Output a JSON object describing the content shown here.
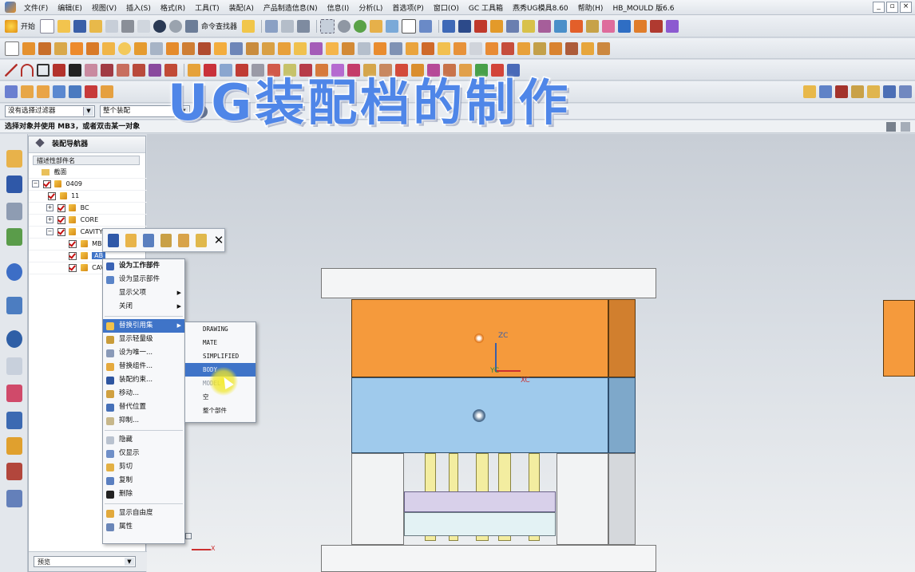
{
  "menubar": {
    "items": [
      "文件(F)",
      "编辑(E)",
      "视图(V)",
      "插入(S)",
      "格式(R)",
      "工具(T)",
      "装配(A)",
      "产品制造信息(N)",
      "信息(I)",
      "分析(L)",
      "首选项(P)",
      "窗口(O)",
      "GC 工具箱",
      "燕秀UG模具8.60",
      "帮助(H)",
      "HB_MOULD 版6.6"
    ]
  },
  "toolbar1": {
    "start_label": "开始",
    "cmd_finder_label": "命令查找器"
  },
  "filterbar": {
    "filter_value": "没有选择过滤器",
    "scope_value": "整个装配"
  },
  "status": {
    "prompt": "选择对象并使用 MB3，或者双击某一对象"
  },
  "navigator": {
    "title": "装配导航器",
    "column_header": "描述性部件名",
    "rows": [
      {
        "label": "截面",
        "level": 1,
        "expander": "",
        "checked": false
      },
      {
        "label": "0409",
        "level": 0,
        "expander": "−",
        "checked": true
      },
      {
        "label": "11",
        "level": 1,
        "expander": "",
        "checked": true
      },
      {
        "label": "BC",
        "level": 1,
        "expander": "+",
        "checked": true
      },
      {
        "label": "CORE",
        "level": 1,
        "expander": "+",
        "checked": true
      },
      {
        "label": "CAVITY",
        "level": 1,
        "expander": "−",
        "checked": true
      },
      {
        "label": "MB",
        "level": 2,
        "expander": "",
        "checked": true
      },
      {
        "label": "AB",
        "level": 2,
        "expander": "",
        "checked": true,
        "selected": true
      },
      {
        "label": "CAV",
        "level": 2,
        "expander": "",
        "checked": true
      }
    ],
    "preview_label": "预览"
  },
  "context_menu": {
    "items": [
      {
        "label": "设为工作部件",
        "bold": true,
        "icon": "work-part-icon"
      },
      {
        "label": "设为显示部件",
        "icon": "display-part-icon"
      },
      {
        "label": "显示父项",
        "submenu": true
      },
      {
        "label": "关闭",
        "submenu": true
      },
      {
        "divider": true
      },
      {
        "label": "替换引用集",
        "submenu": true,
        "highlight": true,
        "icon": "refset-icon"
      },
      {
        "label": "显示轻量级",
        "icon": "lightweight-icon"
      },
      {
        "label": "设为唯一...",
        "icon": "unique-icon"
      },
      {
        "label": "替换组件...",
        "icon": "replace-component-icon"
      },
      {
        "label": "装配约束...",
        "icon": "constraint-icon"
      },
      {
        "label": "移动...",
        "icon": "move-icon"
      },
      {
        "label": "替代位置",
        "icon": "alt-position-icon"
      },
      {
        "label": "抑制...",
        "icon": "suppress-icon"
      },
      {
        "divider": true
      },
      {
        "label": "隐藏",
        "icon": "hide-icon"
      },
      {
        "label": "仅显示",
        "icon": "show-only-icon"
      },
      {
        "label": "剪切",
        "icon": "cut-icon"
      },
      {
        "label": "复制",
        "icon": "copy-icon"
      },
      {
        "label": "删除",
        "icon": "delete-icon"
      },
      {
        "divider": true
      },
      {
        "label": "显示自由度",
        "icon": "dof-icon"
      },
      {
        "label": "属性",
        "icon": "properties-icon"
      }
    ]
  },
  "refset_menu": {
    "items": [
      "DRAWING",
      "MATE",
      "SIMPLIFIED",
      "BODY",
      "MODEL",
      "空",
      "整个部件"
    ],
    "selected": "BODY"
  },
  "viewport": {
    "axis_zc": "ZC",
    "axis_yc": "YC",
    "axis_xc": "XC",
    "triad_x": "X"
  },
  "overlay": {
    "title": "UG装配档的制作"
  },
  "colors": {
    "plate_orange": "#f59a3c",
    "plate_blue": "#9fcaec",
    "plate_grey": "#f2f3f4",
    "pin_yellow": "#f3eda0",
    "menu_highlight": "#3f74c8",
    "overlay_text": "#4f86e8"
  }
}
